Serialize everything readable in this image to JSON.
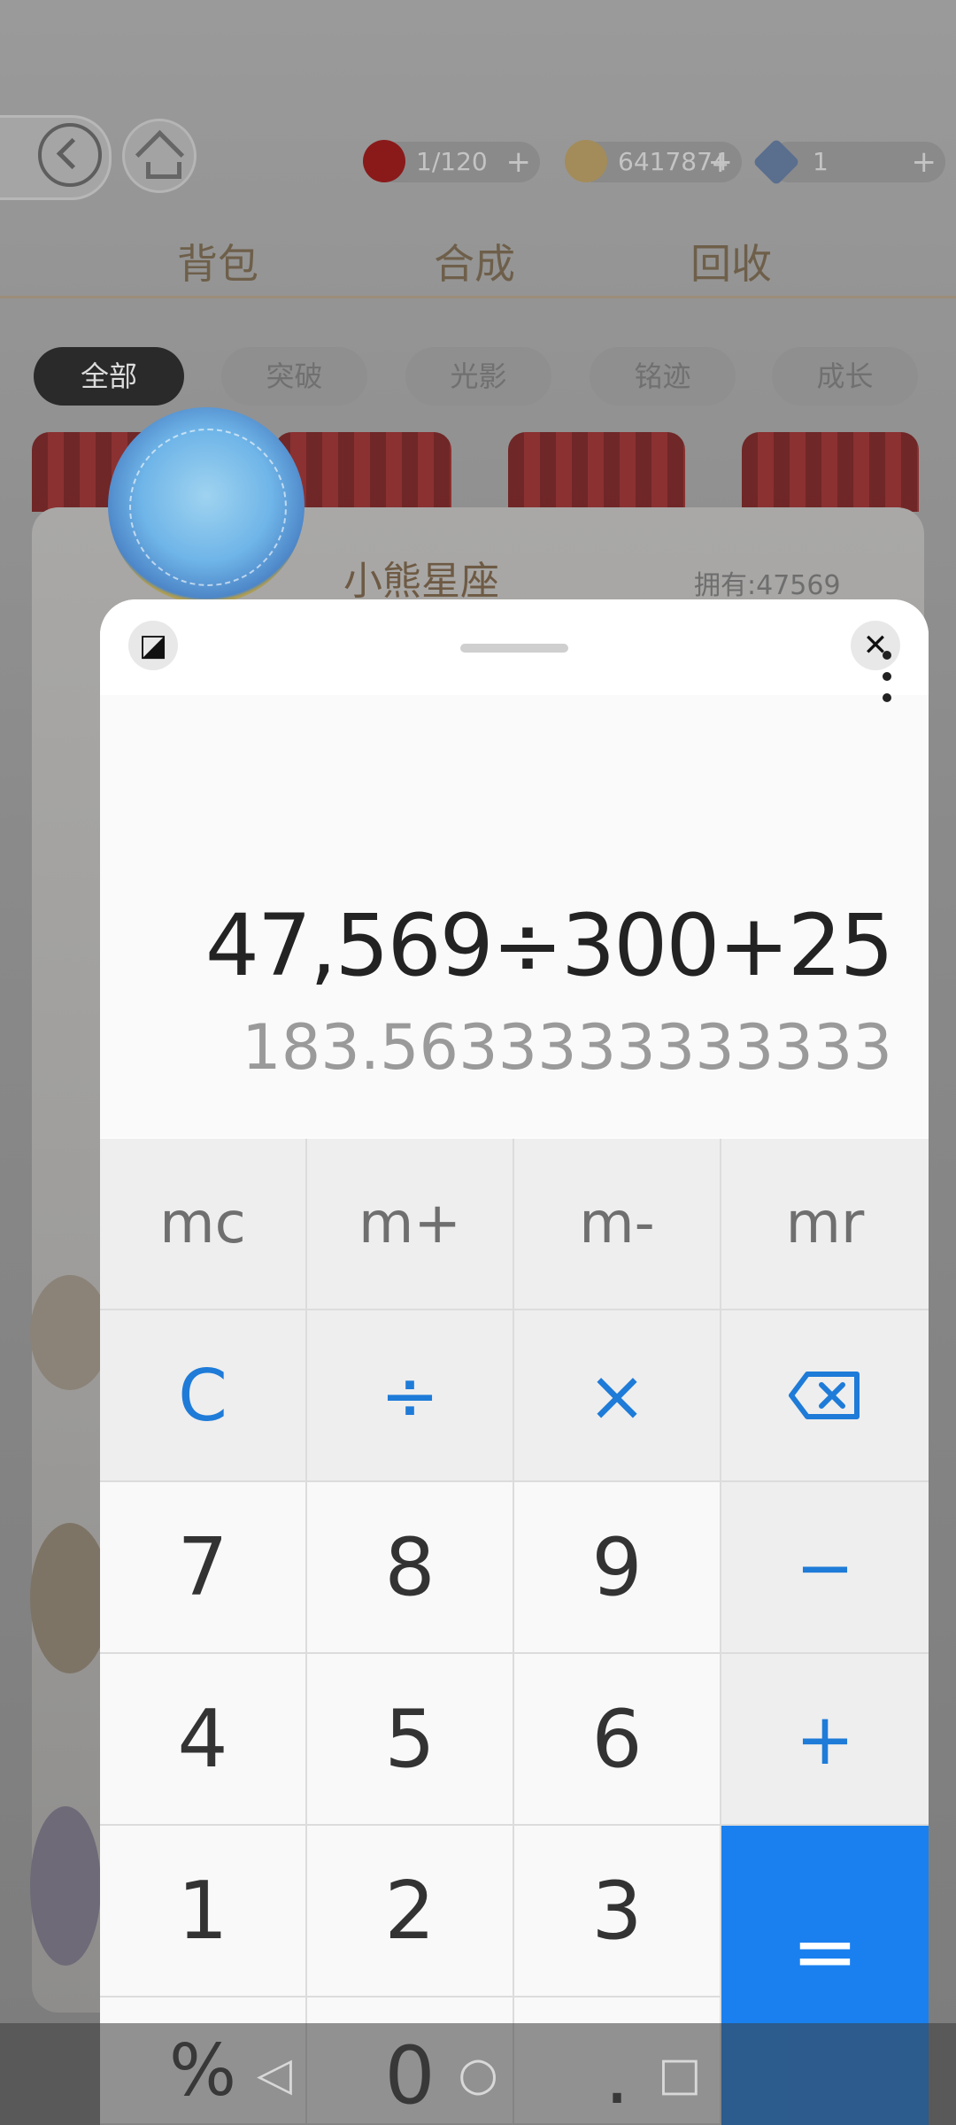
{
  "game": {
    "resources": [
      {
        "icon": "apple-icon",
        "value": "1/120",
        "plus": "+"
      },
      {
        "icon": "coin-icon",
        "value": "6417874",
        "plus": "+"
      },
      {
        "icon": "diamond-icon",
        "value": "1",
        "plus": "+"
      }
    ],
    "tabs": [
      "背包",
      "合成",
      "回收"
    ],
    "filters": [
      "全部",
      "突破",
      "光影",
      "铭迹",
      "成长"
    ],
    "item": {
      "name": "小熊星座",
      "owned": "拥有:47569"
    }
  },
  "calculator": {
    "expression": "47,569÷300+25",
    "result": "183.5633333333333",
    "memory_keys": [
      "mc",
      "m+",
      "m-",
      "mr"
    ],
    "row1": {
      "clear": "C",
      "divide": "÷",
      "multiply": "×",
      "backspace": "⌫"
    },
    "row2": [
      "7",
      "8",
      "9"
    ],
    "minus": "−",
    "row3": [
      "4",
      "5",
      "6"
    ],
    "plus": "+",
    "row4": [
      "1",
      "2",
      "3"
    ],
    "equals": "=",
    "row5": {
      "percent": "%",
      "zero": "0",
      "dot": "."
    }
  },
  "navbar": {
    "back": "◁",
    "home": "○",
    "recents": "□"
  },
  "colors": {
    "accent": "#1e7bd8",
    "equals_bg": "#1a80ef"
  }
}
